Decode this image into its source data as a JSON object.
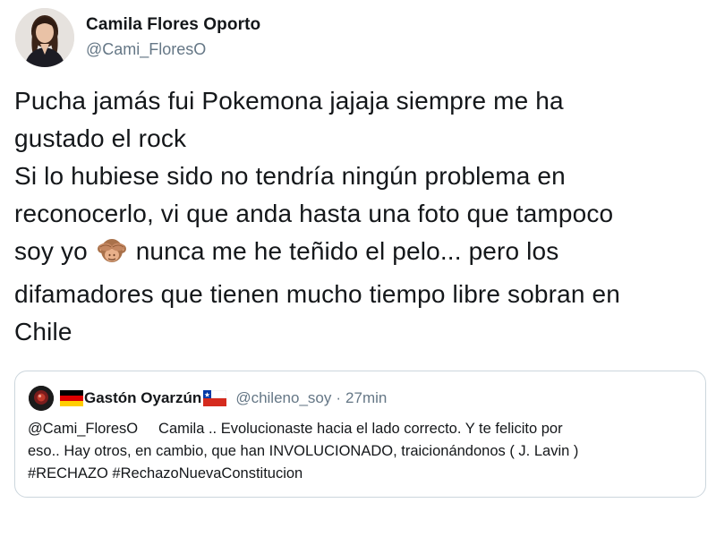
{
  "author": {
    "display_name": "Camila Flores Oporto",
    "handle": "@Cami_FloresO",
    "avatar_icon": "profile-photo"
  },
  "tweet": {
    "lines": [
      "Pucha jamás fui Pokemona jajaja siempre me ha",
      "gustado el rock",
      "Si lo hubiese sido no tendría ningún problema en",
      "reconocerlo, vi que anda hasta una foto que tampoco"
    ],
    "line5_before_emoji": "soy yo",
    "emoji": "see-no-evil-monkey",
    "line5_after_emoji": "nunca me he teñido el pelo... pero los",
    "lines_end": [
      "difamadores que tienen mucho tiempo libre sobran en",
      "Chile"
    ]
  },
  "quoted_tweet": {
    "display_name": "Gastón Oyarzún",
    "flag_before": "germany-flag",
    "flag_after": "chile-flag",
    "handle": "@chileno_soy",
    "separator": "·",
    "time": "27min",
    "lines": [
      "@Cami_FloresO     Camila .. Evolucionaste hacia el lado correcto. Y te felicito por",
      "eso.. Hay otros, en cambio, que han INVOLUCIONADO, traicionándonos ( J. Lavin )",
      "#RECHAZO #RechazoNuevaConstitucion"
    ]
  },
  "colors": {
    "text": "#14171a",
    "secondary": "#657786",
    "border": "#ccd6dd"
  }
}
